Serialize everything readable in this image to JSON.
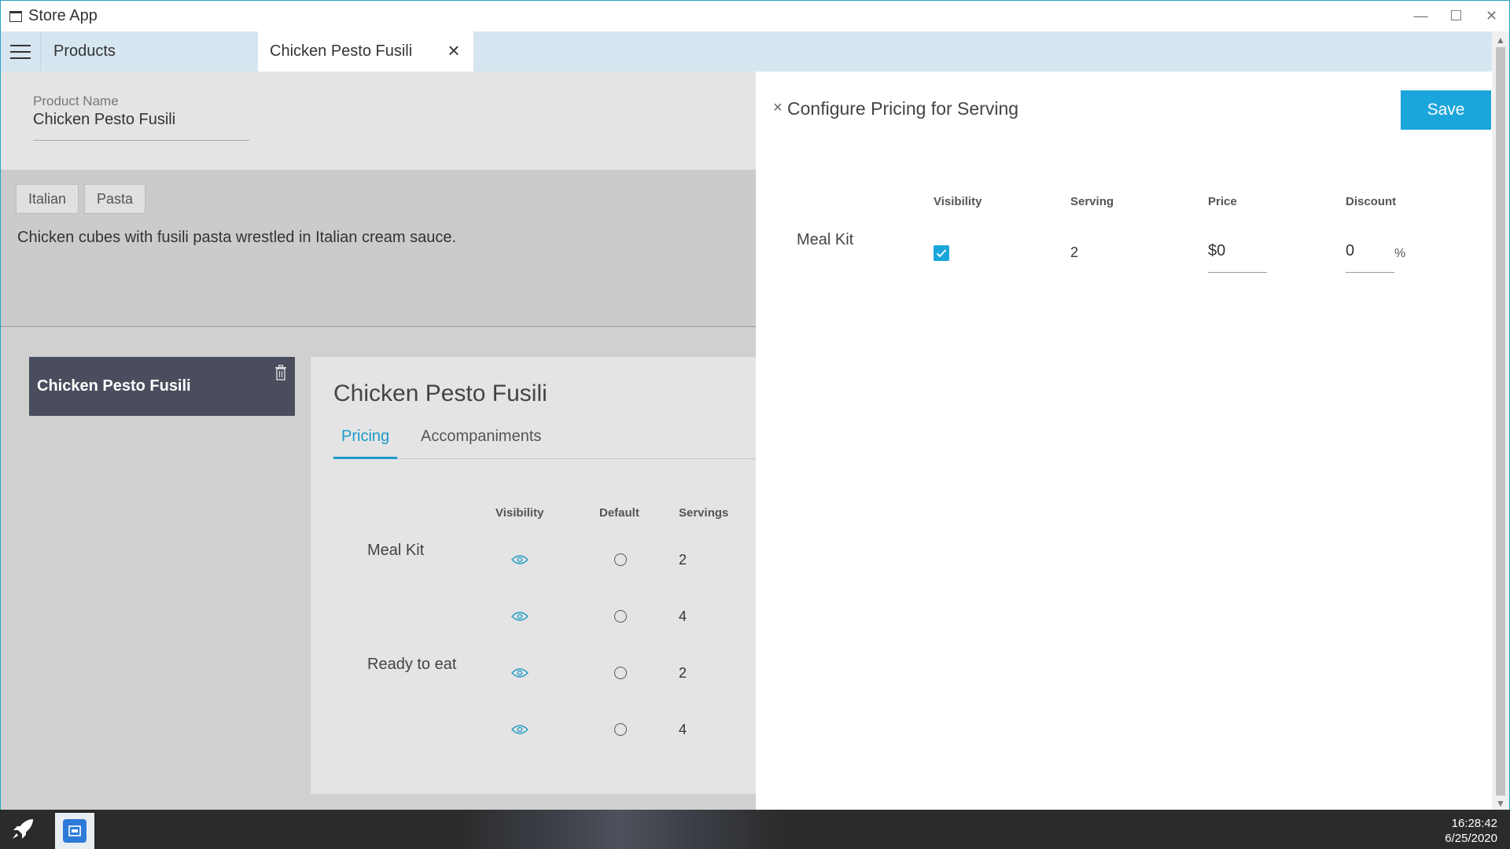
{
  "window": {
    "title": "Store App"
  },
  "tabs": {
    "products": "Products",
    "active": "Chicken Pesto Fusili"
  },
  "product": {
    "name_label": "Product Name",
    "name_value": "Chicken Pesto Fusili",
    "tags": [
      "Italian",
      "Pasta"
    ],
    "description": "Chicken cubes with fusili pasta wrestled in Italian cream sauce."
  },
  "serving_card": {
    "title": "Chicken Pesto Fusili"
  },
  "detail": {
    "title": "Chicken Pesto Fusili",
    "tab_pricing": "Pricing",
    "tab_accompaniments": "Accompaniments",
    "col_visibility": "Visibility",
    "col_default": "Default",
    "col_servings": "Servings",
    "rows": [
      {
        "label": "Meal Kit",
        "servings": "2"
      },
      {
        "label": "",
        "servings": "4"
      },
      {
        "label": "Ready to eat",
        "servings": "2"
      },
      {
        "label": "",
        "servings": "4"
      }
    ]
  },
  "pricing_panel": {
    "title": "Configure Pricing for Serving",
    "save_label": "Save",
    "col_visibility": "Visibility",
    "col_serving": "Serving",
    "col_price": "Price",
    "col_discount": "Discount",
    "row_label": "Meal Kit",
    "visible_checked": true,
    "serving": "2",
    "price_prefix": "$",
    "price_value": "0",
    "discount_value": "0",
    "discount_suffix": "%"
  },
  "taskbar": {
    "time": "16:28:42",
    "date": "6/25/2020"
  },
  "colors": {
    "accent": "#1aa5db",
    "card": "#4a4d5e",
    "tabstrip": "#d6e6f0"
  }
}
